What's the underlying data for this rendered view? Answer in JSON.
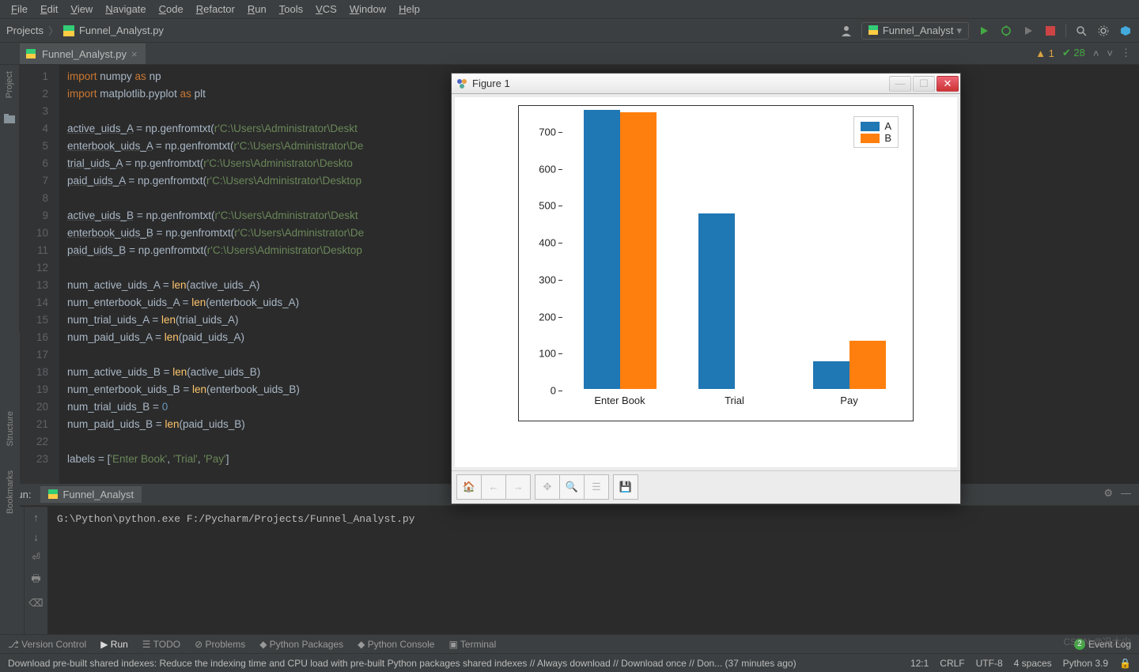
{
  "menu": [
    "File",
    "Edit",
    "View",
    "Navigate",
    "Code",
    "Refactor",
    "Run",
    "Tools",
    "VCS",
    "Window",
    "Help"
  ],
  "breadcrumb": {
    "root": "Projects",
    "file": "Funnel_Analyst.py"
  },
  "run_config": {
    "label": "Funnel_Analyst"
  },
  "tab": {
    "name": "Funnel_Analyst.py"
  },
  "inspection": {
    "warnings": "1",
    "checks": "28"
  },
  "code_lines": [
    {
      "n": 1,
      "html": "<span class='kw'>import</span> numpy <span class='kw'>as</span> np"
    },
    {
      "n": 2,
      "html": "<span class='kw'>import</span> matplotlib.pyplot <span class='kw'>as</span> plt"
    },
    {
      "n": 3,
      "html": ""
    },
    {
      "n": 4,
      "html": "<span class='ul'>active_uids_A</span> = np.genfromtxt(<span class='str'>r'C:\\Users\\Administrator\\Deskt</span>"
    },
    {
      "n": 5,
      "html": "<span class='ul'>enterbook_uids_A</span> = np.genfromtxt(<span class='str'>r'C:\\Users\\Administrator\\De</span>"
    },
    {
      "n": 6,
      "html": "<span class='ul'>trial_uids_A</span> = np.genfromtxt(<span class='str'>r'C:\\Users\\Administrator\\Deskto</span>"
    },
    {
      "n": 7,
      "html": "<span class='ul'>paid_uids_A</span> = np.genfromtxt(<span class='str'>r'C:\\Users\\Administrator\\Desktop</span>"
    },
    {
      "n": 8,
      "html": ""
    },
    {
      "n": 9,
      "html": "<span class='ul'>active_uids_B</span> = np.genfromtxt(<span class='str'>r'C:\\Users\\Administrator\\Deskt</span>"
    },
    {
      "n": 10,
      "html": "<span class='ul'>enterbook_uids_B</span> = np.genfromtxt(<span class='str'>r'C:\\Users\\Administrator\\De</span>"
    },
    {
      "n": 11,
      "html": "<span class='ul'>paid_uids_B</span> = np.genfromtxt(<span class='str'>r'C:\\Users\\Administrator\\Desktop</span>"
    },
    {
      "n": 12,
      "html": ""
    },
    {
      "n": 13,
      "html": "num_active_uids_A = <span class='fn'>len</span>(active_uids_A)"
    },
    {
      "n": 14,
      "html": "num_enterbook_uids_A = <span class='fn'>len</span>(enterbook_uids_A)"
    },
    {
      "n": 15,
      "html": "num_trial_uids_A = <span class='fn'>len</span>(trial_uids_A)"
    },
    {
      "n": 16,
      "html": "num_paid_uids_A = <span class='fn'>len</span>(paid_uids_A)"
    },
    {
      "n": 17,
      "html": ""
    },
    {
      "n": 18,
      "html": "num_active_uids_B = <span class='fn'>len</span>(active_uids_B)"
    },
    {
      "n": 19,
      "html": "num_enterbook_uids_B = <span class='fn'>len</span>(enterbook_uids_B)"
    },
    {
      "n": 20,
      "html": "num_trial_uids_B = <span class='num'>0</span>"
    },
    {
      "n": 21,
      "html": "num_paid_uids_B = <span class='fn'>len</span>(paid_uids_B)"
    },
    {
      "n": 22,
      "html": ""
    },
    {
      "n": 23,
      "html": "labels = [<span class='str'>'Enter Book'</span>, <span class='str'>'Trial'</span>, <span class='str'>'Pay'</span>]"
    }
  ],
  "run_panel": {
    "title": "Run:",
    "tab": "Funnel_Analyst",
    "console": "G:\\Python\\python.exe F:/Pycharm/Projects/Funnel_Analyst.py"
  },
  "tool_windows": [
    "Version Control",
    "Run",
    "TODO",
    "Problems",
    "Python Packages",
    "Python Console",
    "Terminal"
  ],
  "event_log": "Event Log",
  "status": {
    "msg": "Download pre-built shared indexes: Reduce the indexing time and CPU load with pre-built Python packages shared indexes // Always download // Download once // Don... (37 minutes ago)",
    "pos": "12:1",
    "eol": "CRLF",
    "enc": "UTF-8",
    "indent": "4 spaces",
    "lang": "Python 3.9"
  },
  "left_tabs": [
    "Project",
    "Structure",
    "Bookmarks"
  ],
  "figure": {
    "title": "Figure 1"
  },
  "chart_data": {
    "type": "bar",
    "categories": [
      "Enter Book",
      "Trial",
      "Pay"
    ],
    "series": [
      {
        "name": "A",
        "values": [
          755,
          475,
          75
        ],
        "color": "#1f77b4"
      },
      {
        "name": "B",
        "values": [
          750,
          0,
          130
        ],
        "color": "#ff7f0e"
      }
    ],
    "yticks": [
      0,
      100,
      200,
      300,
      400,
      500,
      600,
      700
    ],
    "ylim": [
      0,
      760
    ],
    "xlabel": "",
    "ylabel": "",
    "title": ""
  },
  "watermark": "CSDN @冯大少"
}
